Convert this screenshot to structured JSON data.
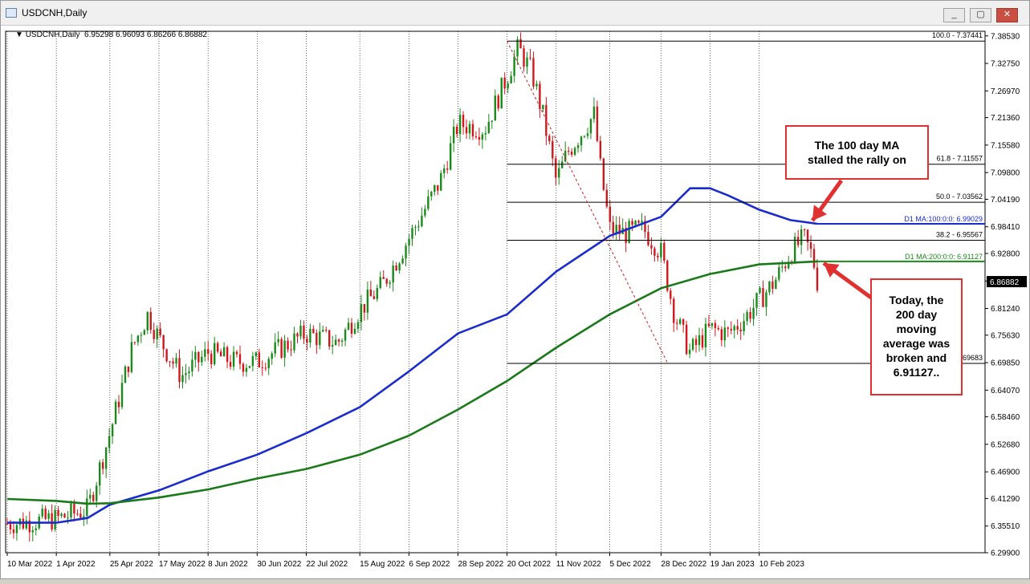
{
  "window": {
    "title": "USDCNH,Daily",
    "buttons": [
      "minimize",
      "maximize",
      "close"
    ]
  },
  "header": {
    "symbol": "USDCNH,Daily",
    "ohlc": "6.95298 6.96093 6.86266 6.86882"
  },
  "chart_data": {
    "type": "candlestick",
    "symbol": "USDCNH",
    "timeframe": "Daily",
    "ylim": [
      6.299,
      7.395
    ],
    "y_ticks": [
      "7.38530",
      "7.32750",
      "7.26970",
      "7.21360",
      "7.15580",
      "7.09800",
      "7.04190",
      "6.98410",
      "6.92800",
      "6.87020",
      "6.81240",
      "6.75630",
      "6.69850",
      "6.64070",
      "6.58460",
      "6.52680",
      "6.46900",
      "6.41290",
      "6.35510",
      "6.29900"
    ],
    "x_ticks": [
      "10 Mar 2022",
      "1 Apr 2022",
      "25 Apr 2022",
      "17 May 2022",
      "8 Jun 2022",
      "30 Jun 2022",
      "22 Jul 2022",
      "15 Aug 2022",
      "6 Sep 2022",
      "28 Sep 2022",
      "20 Oct 2022",
      "11 Nov 2022",
      "5 Dec 2022",
      "28 Dec 2022",
      "19 Jan 2023",
      "10 Feb 2023"
    ],
    "current_price": "6.86882",
    "price_path": [
      [
        "10 Mar 2022",
        6.36
      ],
      [
        "1 Apr 2022",
        6.37
      ],
      [
        "15 Apr 2022",
        6.39
      ],
      [
        "25 Apr 2022",
        6.55
      ],
      [
        "5 May 2022",
        6.73
      ],
      [
        "12 May 2022",
        6.8
      ],
      [
        "17 May 2022",
        6.75
      ],
      [
        "27 May 2022",
        6.67
      ],
      [
        "8 Jun 2022",
        6.72
      ],
      [
        "20 Jun 2022",
        6.7
      ],
      [
        "30 Jun 2022",
        6.7
      ],
      [
        "22 Jul 2022",
        6.76
      ],
      [
        "5 Aug 2022",
        6.74
      ],
      [
        "15 Aug 2022",
        6.81
      ],
      [
        "25 Aug 2022",
        6.86
      ],
      [
        "6 Sep 2022",
        6.96
      ],
      [
        "20 Sep 2022",
        7.08
      ],
      [
        "28 Sep 2022",
        7.2
      ],
      [
        "10 Oct 2022",
        7.19
      ],
      [
        "20 Oct 2022",
        7.3
      ],
      [
        "25 Oct 2022",
        7.36
      ],
      [
        "31 Oct 2022",
        7.31
      ],
      [
        "5 Nov 2022",
        7.22
      ],
      [
        "11 Nov 2022",
        7.08
      ],
      [
        "16 Nov 2022",
        7.14
      ],
      [
        "22 Nov 2022",
        7.18
      ],
      [
        "28 Nov 2022",
        7.22
      ],
      [
        "1 Dec 2022",
        7.1
      ],
      [
        "5 Dec 2022",
        6.98
      ],
      [
        "12 Dec 2022",
        6.97
      ],
      [
        "20 Dec 2022",
        6.98
      ],
      [
        "28 Dec 2022",
        6.93
      ],
      [
        "3 Jan 2023",
        6.8
      ],
      [
        "10 Jan 2023",
        6.72
      ],
      [
        "19 Jan 2023",
        6.77
      ],
      [
        "27 Jan 2023",
        6.76
      ],
      [
        "3 Feb 2023",
        6.79
      ],
      [
        "10 Feb 2023",
        6.83
      ],
      [
        "17 Feb 2023",
        6.87
      ],
      [
        "24 Feb 2023",
        6.93
      ],
      [
        "2 Mar 2023",
        6.96
      ],
      [
        "6 Mar 2023",
        6.92
      ],
      [
        "8 Mar 2023",
        6.87
      ]
    ],
    "ma100": [
      [
        "10 Mar 2022",
        6.362
      ],
      [
        "1 Apr 2022",
        6.362
      ],
      [
        "15 Apr 2022",
        6.372
      ],
      [
        "25 Apr 2022",
        6.4
      ],
      [
        "17 May 2022",
        6.43
      ],
      [
        "8 Jun 2022",
        6.47
      ],
      [
        "30 Jun 2022",
        6.505
      ],
      [
        "22 Jul 2022",
        6.55
      ],
      [
        "15 Aug 2022",
        6.605
      ],
      [
        "6 Sep 2022",
        6.68
      ],
      [
        "28 Sep 2022",
        6.76
      ],
      [
        "20 Oct 2022",
        6.8
      ],
      [
        "11 Nov 2022",
        6.89
      ],
      [
        "5 Dec 2022",
        6.965
      ],
      [
        "28 Dec 2022",
        7.005
      ],
      [
        "10 Jan 2023",
        7.065
      ],
      [
        "19 Jan 2023",
        7.065
      ],
      [
        "27 Jan 2023",
        7.05
      ],
      [
        "10 Feb 2023",
        7.02
      ],
      [
        "24 Feb 2023",
        6.998
      ],
      [
        "8 Mar 2023",
        6.99029
      ]
    ],
    "ma200": [
      [
        "10 Mar 2022",
        6.412
      ],
      [
        "1 Apr 2022",
        6.408
      ],
      [
        "15 Apr 2022",
        6.402
      ],
      [
        "25 Apr 2022",
        6.403
      ],
      [
        "17 May 2022",
        6.415
      ],
      [
        "8 Jun 2022",
        6.432
      ],
      [
        "30 Jun 2022",
        6.455
      ],
      [
        "22 Jul 2022",
        6.475
      ],
      [
        "15 Aug 2022",
        6.505
      ],
      [
        "6 Sep 2022",
        6.545
      ],
      [
        "28 Sep 2022",
        6.6
      ],
      [
        "20 Oct 2022",
        6.66
      ],
      [
        "11 Nov 2022",
        6.73
      ],
      [
        "5 Dec 2022",
        6.8
      ],
      [
        "28 Dec 2022",
        6.855
      ],
      [
        "19 Jan 2023",
        6.885
      ],
      [
        "10 Feb 2023",
        6.905
      ],
      [
        "8 Mar 2023",
        6.91127
      ]
    ],
    "fib_levels": [
      {
        "label": "100.0 - 7.37441",
        "value": 7.37441
      },
      {
        "label": "61.8 - 7.11557",
        "value": 7.11557
      },
      {
        "label": "50.0 - 7.03562",
        "value": 7.03562
      },
      {
        "label": "38.2 - 6.95567",
        "value": 6.95567
      },
      {
        "label": "6.69683",
        "value": 6.69683
      }
    ],
    "ma_labels": [
      {
        "label": "D1 MA:100:0:0: 6.99029",
        "value": 6.99029,
        "color": "#1a2ccc"
      },
      {
        "label": "D1 MA:200:0:0: 6.91127",
        "value": 6.91127,
        "color": "#1a8a1a"
      }
    ],
    "colors": {
      "bull": "#1a8a1a",
      "bear": "#d0181c",
      "ma100": "#1a2ccc",
      "ma200": "#1a7a1a",
      "annotation": "#e03030"
    }
  },
  "annotations": {
    "callout1": "The 100 day MA\nstalled the rally on",
    "callout2": "Today, the\n200 day\nmoving\naverage was\nbroken and\n6.91127.."
  }
}
